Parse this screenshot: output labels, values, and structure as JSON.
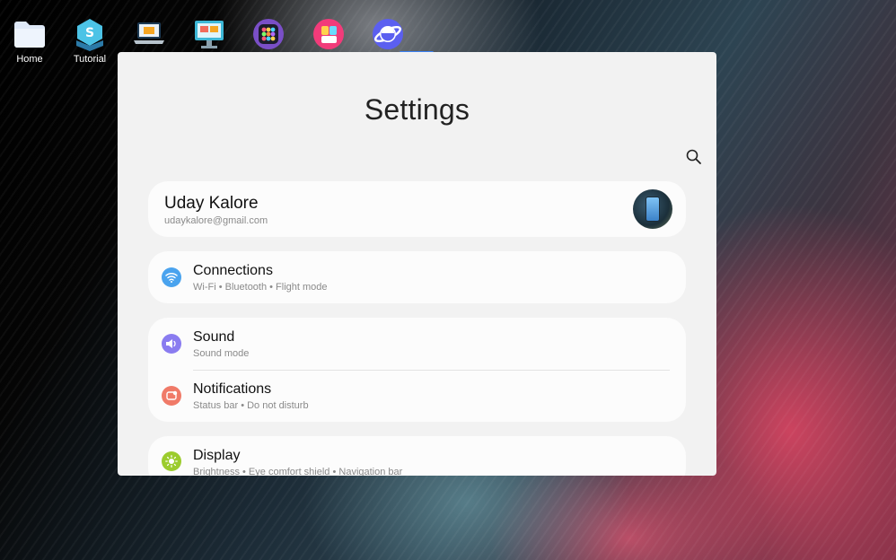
{
  "desktop": {
    "icons": [
      {
        "name": "home",
        "label": "Home"
      },
      {
        "name": "tutorial",
        "label": "Tutorial"
      },
      {
        "name": "laptop-transfer",
        "label": ""
      },
      {
        "name": "screen-share",
        "label": ""
      },
      {
        "name": "app-grid",
        "label": ""
      },
      {
        "name": "pink-app",
        "label": ""
      },
      {
        "name": "internet",
        "label": ""
      }
    ]
  },
  "window": {
    "title": "Settings",
    "profile": {
      "name": "Uday Kalore",
      "email": "udaykalore@gmail.com"
    },
    "items": [
      {
        "title": "Connections",
        "subtitle": "Wi-Fi  •  Bluetooth  •  Flight mode",
        "icon": "wifi-icon",
        "color": "#4aa3ee"
      },
      {
        "title": "Sound",
        "subtitle": "Sound mode",
        "icon": "speaker-icon",
        "color": "#8a7cf0"
      },
      {
        "title": "Notifications",
        "subtitle": "Status bar  •  Do not disturb",
        "icon": "notification-icon",
        "color": "#f07a68"
      },
      {
        "title": "Display",
        "subtitle": "Brightness  •  Eye comfort shield  •  Navigation bar",
        "icon": "sun-icon",
        "color": "#9ccc2e"
      }
    ]
  },
  "colors": {
    "accent": "#3b82f6",
    "window_bg": "#f2f2f2",
    "card_bg": "#fcfcfc"
  }
}
